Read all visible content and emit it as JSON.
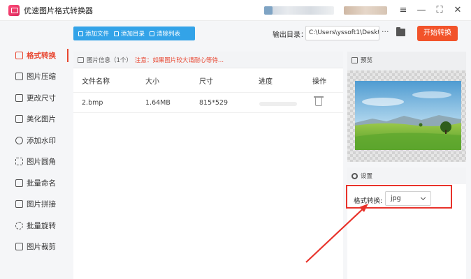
{
  "window": {
    "title": "优速图片格式转换器",
    "controls": [
      "≡",
      "—",
      "⛶",
      "✕"
    ]
  },
  "sidebar": {
    "items": [
      {
        "label": "格式转换",
        "active": true
      },
      {
        "label": "图片压缩"
      },
      {
        "label": "更改尺寸"
      },
      {
        "label": "美化图片"
      },
      {
        "label": "添加水印"
      },
      {
        "label": "图片圆角"
      },
      {
        "label": "批量命名"
      },
      {
        "label": "图片拼接"
      },
      {
        "label": "批量旋转"
      },
      {
        "label": "图片裁剪"
      }
    ]
  },
  "toolbar": {
    "add_file": "添加文件",
    "add_folder": "添加目录",
    "clear_list": "清除列表"
  },
  "output": {
    "label": "输出目录：",
    "path": "C:\\Users\\yssoft1\\Deskto",
    "more": "···",
    "start": "开始转换"
  },
  "file_panel": {
    "header": "图片信息（1个）",
    "notice": "注意：如果图片较大请耐心等待...",
    "columns": [
      "文件名称",
      "大小",
      "尺寸",
      "进度",
      "操作"
    ],
    "rows": [
      {
        "name": "2.bmp",
        "size": "1.64MB",
        "dims": "815*529",
        "progress": 0
      }
    ]
  },
  "preview": {
    "title": "预览"
  },
  "settings": {
    "title": "设置",
    "format_label": "格式转换:",
    "format_value": "jpg"
  },
  "colors": {
    "accent": "#e8452f",
    "toolbar_blue": "#33a3e8",
    "start_button": "#f2532a",
    "highlight_box": "#e8322a"
  }
}
